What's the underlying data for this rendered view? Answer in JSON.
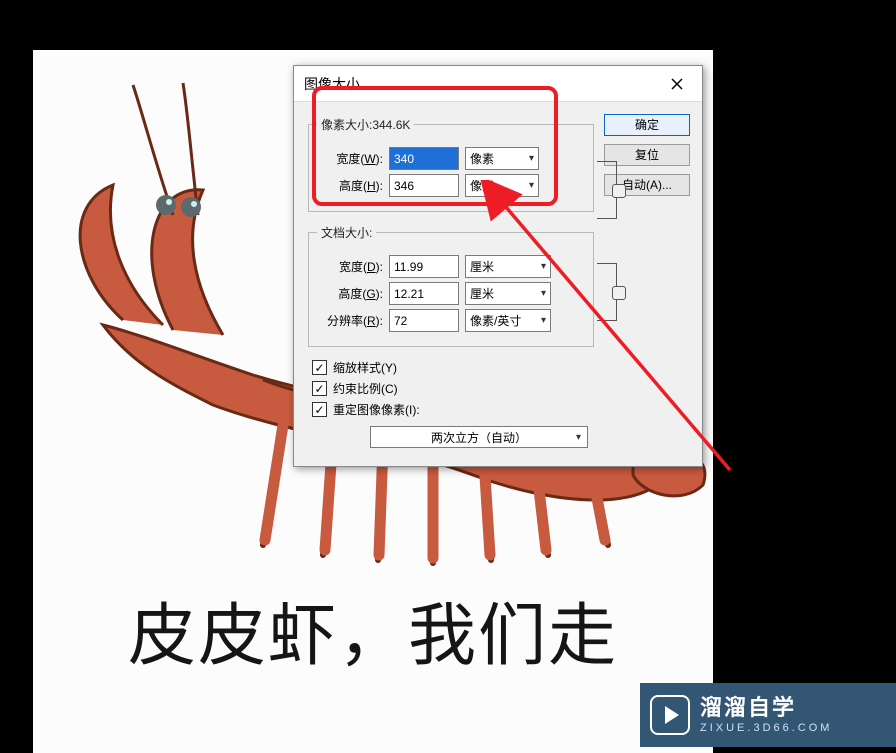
{
  "canvas": {
    "caption": "皮皮虾，我们走"
  },
  "dialog": {
    "title": "图像大小",
    "pixel_legend": "像素大小:344.6K",
    "width_label": "宽度(",
    "width_u": "W",
    "width_after": "):",
    "width_val": "340",
    "width_unit": "像素",
    "height_label": "高度(",
    "height_u": "H",
    "height_after": "):",
    "height_val": "346",
    "height_unit": "像素",
    "doc_legend": "文档大小:",
    "doc_width_label": "宽度(",
    "doc_width_u": "D",
    "doc_width_after": "):",
    "doc_width_val": "11.99",
    "doc_width_unit": "厘米",
    "doc_height_label": "高度(",
    "doc_height_u": "G",
    "doc_height_after": "):",
    "doc_height_val": "12.21",
    "doc_height_unit": "厘米",
    "res_label": "分辨率(",
    "res_u": "R",
    "res_after": "):",
    "res_val": "72",
    "res_unit": "像素/英寸",
    "chk_scale": "缩放样式(",
    "chk_scale_u": "Y",
    "chk_scale_after": ")",
    "chk_ratio": "约束比例(",
    "chk_ratio_u": "C",
    "chk_ratio_after": ")",
    "chk_resample": "重定图像像素(",
    "chk_resample_u": "I",
    "chk_resample_after": "):",
    "resample_method": "两次立方（自动）",
    "btn_ok": "确定",
    "btn_reset": "复位",
    "btn_auto": "自动(A)..."
  },
  "watermark": {
    "name": "溜溜自学",
    "url": "ZIXUE.3D66.COM"
  }
}
